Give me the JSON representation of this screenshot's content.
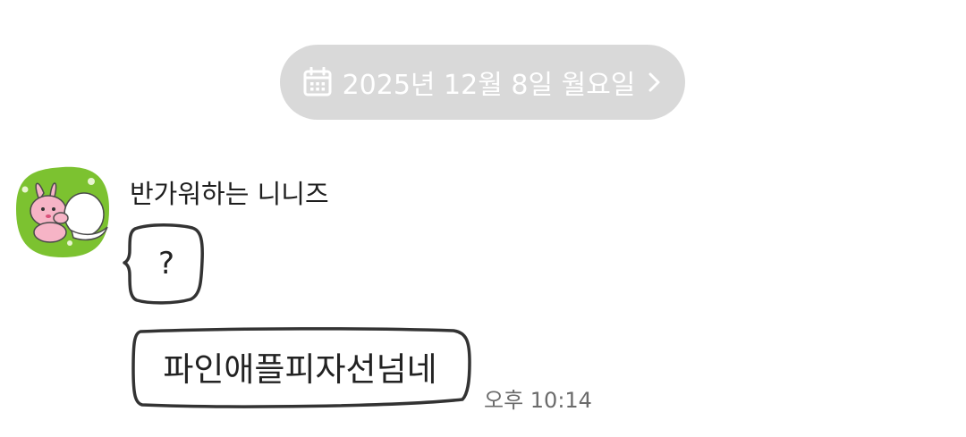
{
  "date_separator": {
    "icon": "calendar-icon",
    "label": "2025년 12월 8일 월요일",
    "chevron_icon": "chevron-right-icon",
    "background": "#d9d9d9",
    "text_color": "#ffffff"
  },
  "message_group": {
    "avatar": {
      "icon": "rabbit-sticker-avatar",
      "background": "#7cc230"
    },
    "sender_name": "반가워하는 니니즈",
    "messages": [
      {
        "text": "?"
      },
      {
        "text": "파인애플피자선넘네"
      }
    ],
    "timestamp": "오후 10:14"
  }
}
